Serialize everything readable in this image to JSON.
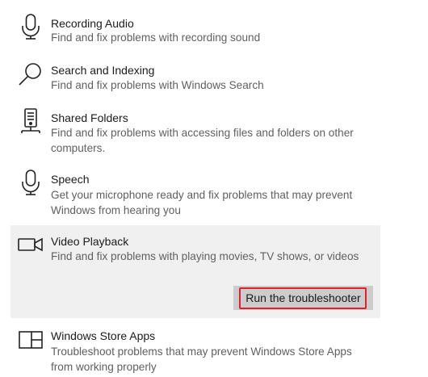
{
  "items": [
    {
      "title": "Recording Audio",
      "description": "Find and fix problems with recording sound",
      "icon": "microphone-icon"
    },
    {
      "title": "Search and Indexing",
      "description": "Find and fix problems with Windows Search",
      "icon": "search-icon"
    },
    {
      "title": "Shared Folders",
      "description": "Find and fix problems with accessing files and folders on other computers.",
      "icon": "shared-folders-icon"
    },
    {
      "title": "Speech",
      "description": "Get your microphone ready and fix problems that may prevent Windows from hearing you",
      "icon": "microphone-icon"
    },
    {
      "title": "Video Playback",
      "description": "Find and fix problems with playing movies, TV shows, or videos",
      "icon": "video-camera-icon",
      "selected": true
    },
    {
      "title": "Windows Store Apps",
      "description": "Troubleshoot problems that may prevent Windows Store Apps from working properly",
      "icon": "store-apps-icon"
    }
  ],
  "run_button_label": "Run the troubleshooter",
  "colors": {
    "selected_background": "#f0f0f0",
    "button_background": "#cccccc",
    "highlight_outline": "#e0202c",
    "description_text": "#606060"
  }
}
